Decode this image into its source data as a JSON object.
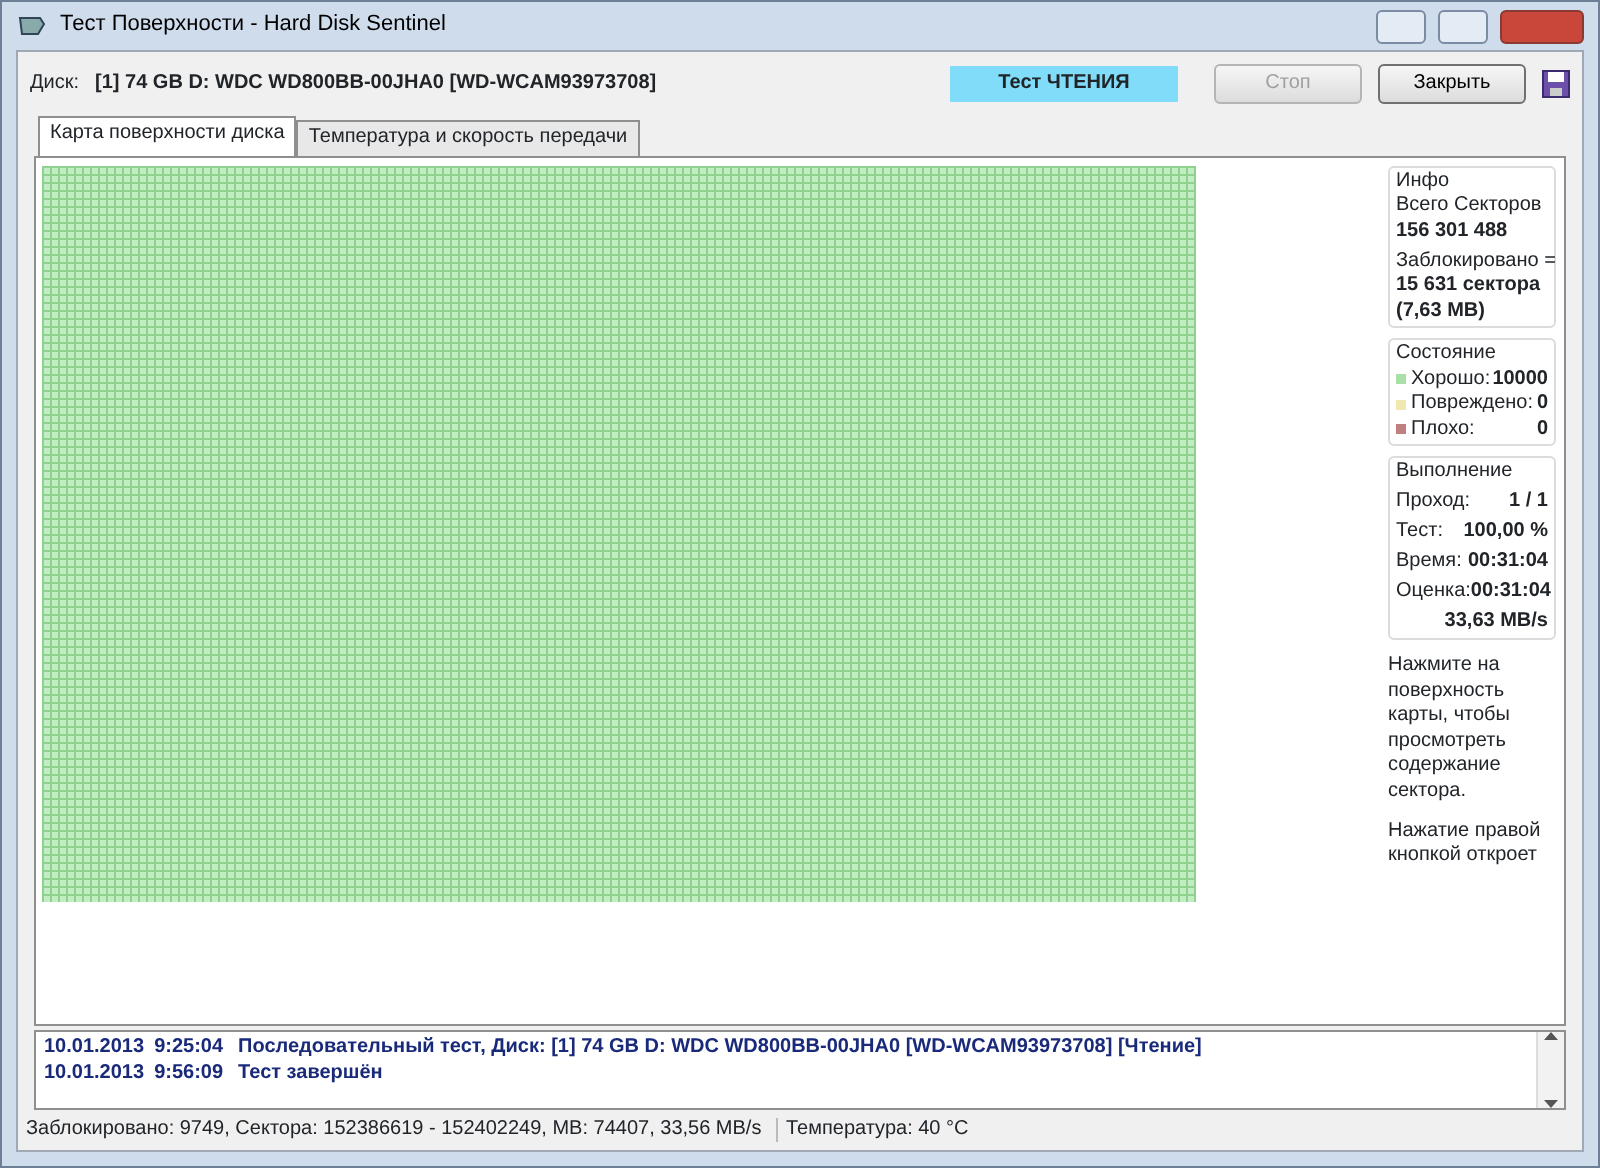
{
  "window": {
    "title": "Тест Поверхности - Hard Disk Sentinel"
  },
  "toolbar": {
    "disk_label": "Диск:",
    "disk": "[1] 74 GB D: WDC WD800BB-00JHA0 [WD-WCAM93973708]",
    "test_status": "Тест ЧТЕНИЯ",
    "buttons": [
      {
        "label": "Стоп",
        "disabled": true
      },
      {
        "label": "Закрыть",
        "disabled": false
      }
    ]
  },
  "tabs": [
    {
      "label": "Карта поверхности диска",
      "selected": true
    },
    {
      "label": "Температура и скорость передачи",
      "selected": false
    }
  ],
  "info": {
    "title": "Инфо",
    "total_label": "Всего Секторов",
    "total": "156 301 488",
    "blocked_label": "Заблокировано =",
    "blocked": "15 631 сектора",
    "blocked_size": "(7,63 MB)"
  },
  "state": {
    "title": "Состояние",
    "items": [
      {
        "label": "Хорошо:",
        "value": "10000",
        "color": "#a8e0a8"
      },
      {
        "label": "Повреждено:",
        "value": "0",
        "color": "#f0e8b0"
      },
      {
        "label": "Плохо:",
        "value": "0",
        "color": "#c08080"
      }
    ]
  },
  "progress": {
    "title": "Выполнение",
    "rows": [
      {
        "label": "Проход:",
        "value": "1 / 1"
      },
      {
        "label": "Тест:",
        "value": "100,00 %"
      },
      {
        "label": "Время:",
        "value": "00:31:04"
      },
      {
        "label": "Оценка:",
        "value": "00:31:04"
      }
    ],
    "speed": "33,63 MB/s"
  },
  "hints": [
    "Нажмите на поверхность карты, чтобы просмотреть содержание сектора.",
    "Нажатие правой кнопкой откроет"
  ],
  "log": [
    {
      "date": "10.01.2013",
      "time": "9:25:04",
      "message": "Последовательный тест, Диск: [1] 74 GB D: WDC WD800BB-00JHA0 [WD-WCAM93973708] [Чтение]"
    },
    {
      "date": "10.01.2013",
      "time": "9:56:09",
      "message": "Тест завершён"
    }
  ],
  "status_bar": [
    "Заблокировано: 9749, Сектора: 152386619 - 152402249, MB: 74407, 33,56 MB/s",
    "Температура: 40  °C"
  ]
}
